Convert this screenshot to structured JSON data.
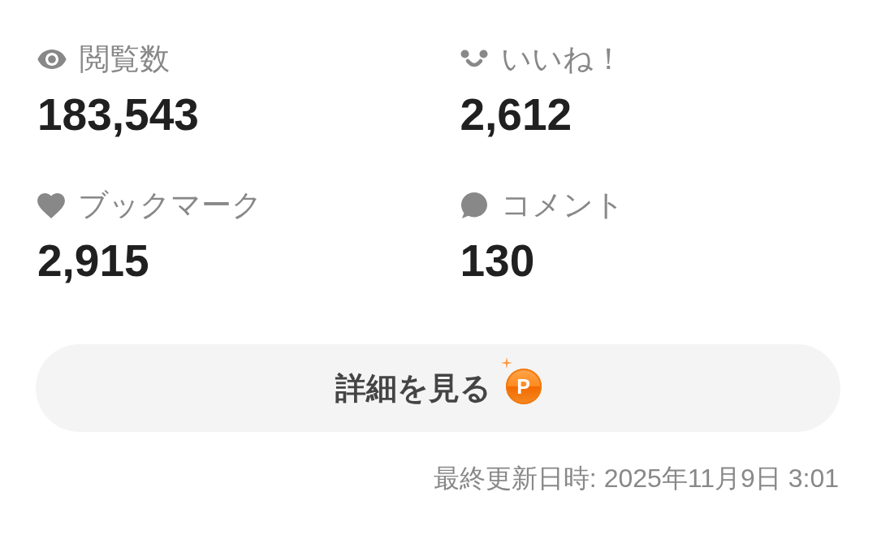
{
  "stats": [
    {
      "kind": "views",
      "label": "閲覧数",
      "value": "183,543"
    },
    {
      "kind": "likes",
      "label": "いいね！",
      "value": "2,612"
    },
    {
      "kind": "bookmarks",
      "label": "ブックマーク",
      "value": "2,915"
    },
    {
      "kind": "comments",
      "label": "コメント",
      "value": "130"
    }
  ],
  "details_button": {
    "label": "詳細を見る",
    "badge": "P"
  },
  "last_updated": "最終更新日時: 2025年11月9日 3:01"
}
